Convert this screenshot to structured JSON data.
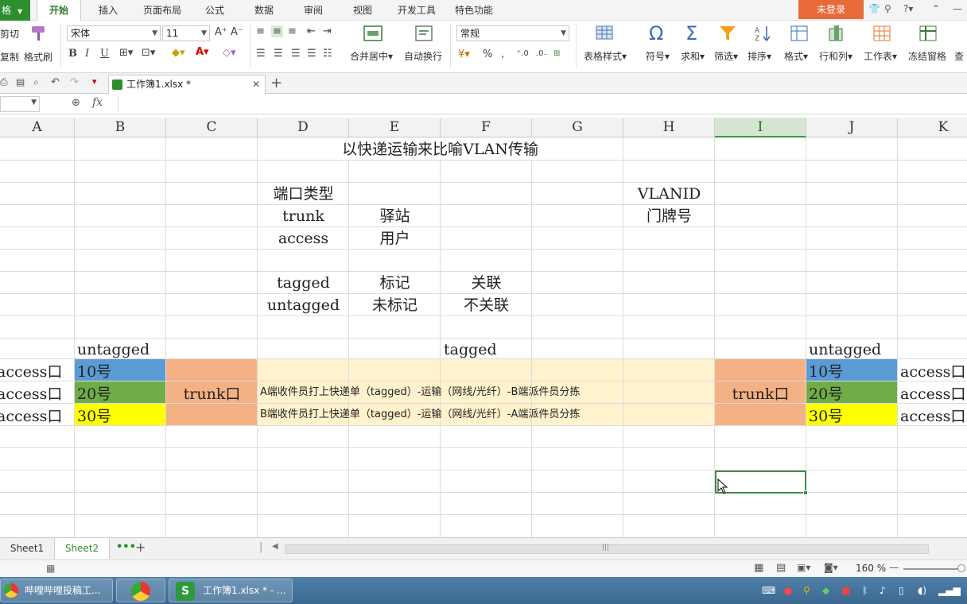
{
  "menubar": {
    "app_label": "格",
    "items": [
      "开始",
      "插入",
      "页面布局",
      "公式",
      "数据",
      "审阅",
      "视图",
      "开发工具",
      "特色功能"
    ],
    "login_label": "未登录",
    "help_label": "?"
  },
  "ribbon": {
    "cut_label": "剪切",
    "copy_label": "复制",
    "format_painter_label": "格式刷",
    "font_name": "宋体",
    "font_size": "11",
    "merge_label": "合并居中",
    "wrap_label": "自动换行",
    "number_format": "常规",
    "table_style_label": "表格样式",
    "symbol_label": "符号",
    "sum_label": "求和",
    "filter_label": "筛选",
    "sort_label": "排序",
    "format_label": "格式",
    "rowcol_label": "行和列",
    "worksheet_label": "工作表",
    "freeze_label": "冻结窗格",
    "find_label": "查",
    "bold": "B",
    "italic": "I",
    "underline": "U",
    "percent": "%",
    "comma": ","
  },
  "doc": {
    "tab_title": "工作簿1.xlsx *",
    "fx_label": "fx"
  },
  "columns": [
    "A",
    "B",
    "C",
    "D",
    "E",
    "F",
    "G",
    "H",
    "I",
    "J",
    "K"
  ],
  "selected_column": "I",
  "cells": {
    "title": "以快递运输来比喻VLAN传输",
    "port_type": "端口类型",
    "trunk": "trunk",
    "station": "驿站",
    "access": "access",
    "user": "用户",
    "vlanid": "VLANID",
    "doorplate": "门牌号",
    "tagged": "tagged",
    "tag_mark": "标记",
    "assoc": "关联",
    "untagged": "untagged",
    "untag_mark": "未标记",
    "not_assoc": "不关联",
    "untagged_left": "untagged",
    "tagged_mid": "tagged",
    "untagged_right": "untagged",
    "access_port": "access口",
    "vlan10": "10号",
    "vlan20": "20号",
    "vlan30": "30号",
    "trunk_port": "trunk口",
    "line_a_to_b": "A端收件员打上快递单（tagged）-运输（网线/光纤）-B端派件员分拣",
    "line_b_to_a": "B端收件员打上快递单（tagged）-运输（网线/光纤）-A端派件员分拣"
  },
  "colors": {
    "blue_cell": "#5b9bd5",
    "green_cell": "#70ad47",
    "yellow_cell": "#ffff00",
    "orange_cell": "#f4b183",
    "cream_cell": "#fff2cc",
    "accent_green": "#2c8e2c"
  },
  "sheets": {
    "tabs": [
      "Sheet1",
      "Sheet2"
    ],
    "active": "Sheet2"
  },
  "status": {
    "zoom": "160 %"
  },
  "taskbar": {
    "items": [
      "哔哩哔哩投稿工...",
      "",
      "工作簿1.xlsx * - ..."
    ]
  }
}
